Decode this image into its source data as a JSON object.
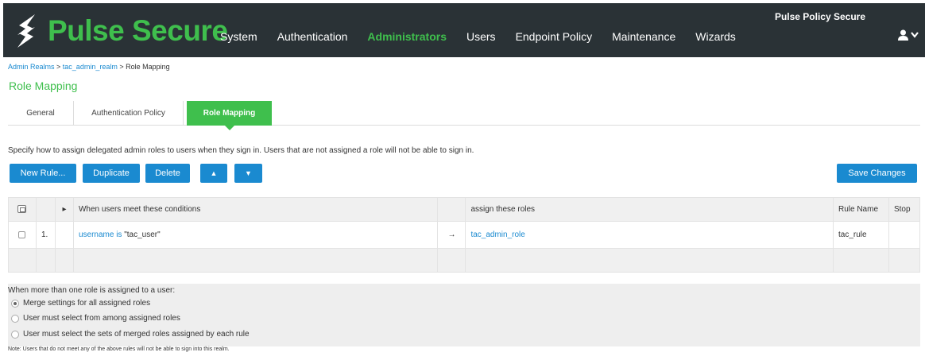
{
  "brand": {
    "name": "Pulse Secure",
    "product": "Pulse Policy Secure",
    "accent": "#3fbf4d",
    "topbar_bg": "#2a3236",
    "link_color": "#1a8ad0"
  },
  "nav": {
    "items": [
      {
        "label": "System"
      },
      {
        "label": "Authentication"
      },
      {
        "label": "Administrators",
        "active": true
      },
      {
        "label": "Users"
      },
      {
        "label": "Endpoint Policy"
      },
      {
        "label": "Maintenance"
      },
      {
        "label": "Wizards"
      }
    ]
  },
  "user_menu": {
    "icon": "user-icon",
    "chevron": "chevron-down-icon"
  },
  "breadcrumb": {
    "link1": "Admin Realms",
    "sep1": " > ",
    "link2": "tac_admin_realm",
    "sep2": " > ",
    "current": "Role Mapping"
  },
  "page_title": "Role Mapping",
  "tabs": [
    {
      "label": "General"
    },
    {
      "label": "Authentication Policy"
    },
    {
      "label": "Role Mapping",
      "active": true
    }
  ],
  "description": "Specify how to assign delegated admin roles to users when they sign in. Users that are not assigned a role will not be able to sign in.",
  "toolbar": {
    "new_rule": "New Rule...",
    "duplicate": "Duplicate",
    "delete": "Delete",
    "move_up": "▲",
    "move_down": "▼",
    "save": "Save Changes"
  },
  "table": {
    "headers": {
      "expand": "▸",
      "conditions": "When users meet these conditions",
      "roles": "assign these roles",
      "rule_name": "Rule Name",
      "stop": "Stop"
    },
    "rows": [
      {
        "index": "1.",
        "condition_field": "username is",
        "condition_value": " \"tac_user\"",
        "arrow": "→",
        "role": "tac_admin_role",
        "rule_name": "tac_rule",
        "stop": ""
      }
    ]
  },
  "multi_role": {
    "heading": "When more than one role is assigned to a user:",
    "options": [
      {
        "label": "Merge settings for all assigned roles",
        "selected": true
      },
      {
        "label": "User must select from among assigned roles",
        "selected": false
      },
      {
        "label": "User must select the sets of merged roles assigned by each rule",
        "selected": false
      }
    ],
    "note": "Note: Users that do not meet any of the above rules will not be able to sign into this realm."
  }
}
